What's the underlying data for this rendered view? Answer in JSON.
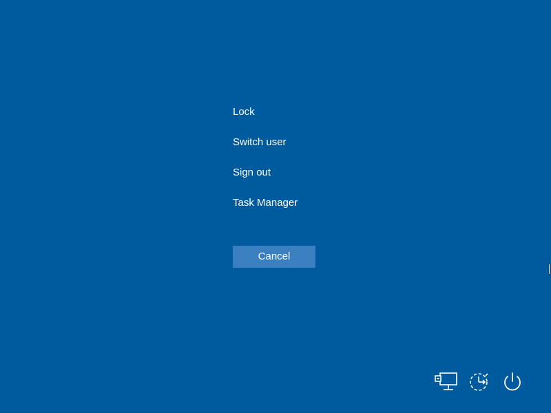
{
  "menu": {
    "items": [
      {
        "label": "Lock"
      },
      {
        "label": "Switch user"
      },
      {
        "label": "Sign out"
      },
      {
        "label": "Task Manager"
      }
    ]
  },
  "cancel": {
    "label": "Cancel"
  },
  "tray": {
    "icons": [
      "network-icon",
      "ease-of-access-icon",
      "power-icon"
    ]
  },
  "colors": {
    "background": "#005a9e",
    "button": "#3a7fbf",
    "text": "#ffffff"
  }
}
